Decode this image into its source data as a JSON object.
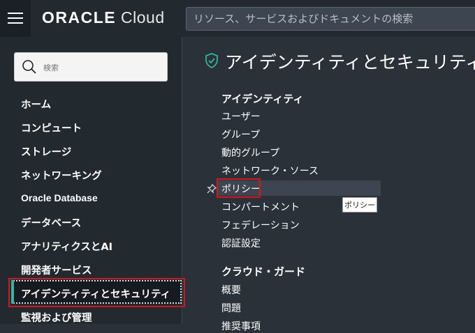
{
  "topbar": {
    "logo_brand": "ORACLE",
    "logo_product": "Cloud",
    "search_placeholder": "リソース、サービスおよびドキュメントの検索"
  },
  "sidebar": {
    "search_placeholder": "検索",
    "items": [
      {
        "label": "ホーム"
      },
      {
        "label": "コンピュート"
      },
      {
        "label": "ストレージ"
      },
      {
        "label": "ネットワーキング"
      },
      {
        "label": "Oracle Database"
      },
      {
        "label": "データベース"
      },
      {
        "label": "アナリティクスとAI"
      },
      {
        "label": "開発者サービス"
      },
      {
        "label": "アイデンティティとセキュリティ",
        "active": true
      },
      {
        "label": "監視および管理"
      }
    ]
  },
  "main": {
    "title": "アイデンティティとセキュリティ",
    "groups": [
      {
        "heading": "アイデンティティ",
        "links": [
          "ユーザー",
          "グループ",
          "動的グループ",
          "ネットワーク・ソース",
          "ポリシー",
          "コンパートメント",
          "フェデレーション",
          "認証設定"
        ]
      },
      {
        "heading": "クラウド・ガード",
        "links": [
          "概要",
          "問題",
          "推奨事項"
        ]
      }
    ],
    "tooltip": "ポリシー"
  },
  "colors": {
    "accent_teal": "#2fb5a0",
    "highlight_red": "#d9151c",
    "sidebar_bg": "#22292f",
    "content_bg": "#2a3139"
  }
}
